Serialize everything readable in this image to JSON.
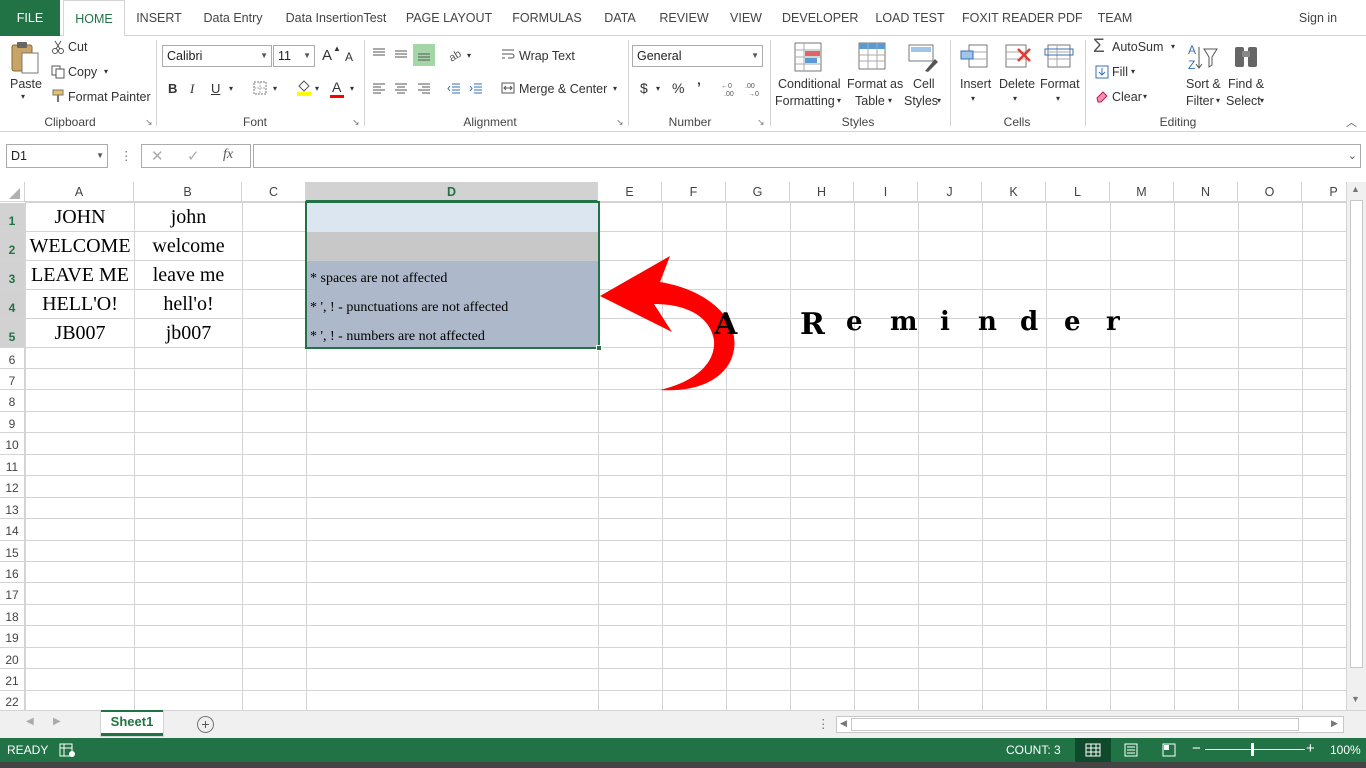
{
  "tabs": [
    "FILE",
    "HOME",
    "INSERT",
    "Data Entry",
    "Data InsertionTest",
    "PAGE LAYOUT",
    "FORMULAS",
    "DATA",
    "REVIEW",
    "VIEW",
    "DEVELOPER",
    "LOAD TEST",
    "FOXIT READER PDF",
    "TEAM"
  ],
  "signin": "Sign in",
  "clipboard": {
    "paste": "Paste",
    "cut": "Cut",
    "copy": "Copy",
    "format_painter": "Format Painter",
    "label": "Clipboard"
  },
  "font": {
    "name": "Calibri",
    "size": "11",
    "label": "Font",
    "bold": "B",
    "italic": "I",
    "underline": "U",
    "grow": "A",
    "shrink": "A",
    "color_a": "A"
  },
  "alignment": {
    "wrap": "Wrap Text",
    "merge": "Merge & Center",
    "label": "Alignment"
  },
  "number": {
    "format": "General",
    "currency": "$",
    "percent": "%",
    "comma": "’",
    "label": "Number"
  },
  "styles": {
    "cond1": "Conditional",
    "cond2": "Formatting",
    "fmt1": "Format as",
    "fmt2": "Table",
    "cell1": "Cell",
    "cell2": "Styles",
    "label": "Styles"
  },
  "cells": {
    "insert": "Insert",
    "delete": "Delete",
    "format": "Format",
    "label": "Cells"
  },
  "editing": {
    "autosum": "AutoSum",
    "fill": "Fill",
    "clear": "Clear",
    "sort1": "Sort &",
    "sort2": "Filter",
    "find1": "Find &",
    "find2": "Select",
    "label": "Editing"
  },
  "namebox": "D1",
  "fx": "fx",
  "columns": [
    "A",
    "B",
    "C",
    "D",
    "E",
    "F",
    "G",
    "H",
    "I",
    "J",
    "K",
    "L",
    "M",
    "N",
    "O",
    "P"
  ],
  "rows": [
    "1",
    "2",
    "3",
    "4",
    "5",
    "6",
    "7",
    "8",
    "9",
    "10",
    "11",
    "12",
    "13",
    "14",
    "15",
    "16",
    "17",
    "18",
    "19",
    "20",
    "21",
    "22"
  ],
  "colA": [
    "JOHN",
    "WELCOME",
    "LEAVE ME",
    "HELL'O!",
    "JB007"
  ],
  "colB": [
    "john",
    "welcome",
    "leave me",
    "hell'o!",
    "jb007"
  ],
  "colD": [
    "",
    "",
    "* spaces are not affected",
    "* ', ! - punctuations are not affected",
    "* ', ! - numbers are not affected"
  ],
  "reminder": [
    "A",
    "R",
    "e",
    "m",
    "i",
    "n",
    "d",
    "e",
    "r"
  ],
  "sheet": "Sheet1",
  "status": {
    "ready": "READY",
    "count": "COUNT: 3",
    "zoom": "100%"
  },
  "colors": {
    "excel_green": "#217346",
    "selection": "#adb9ca",
    "selection_light": "#dce6f1",
    "gray_row": "#c8c8c8",
    "arrow": "#ff0000"
  }
}
